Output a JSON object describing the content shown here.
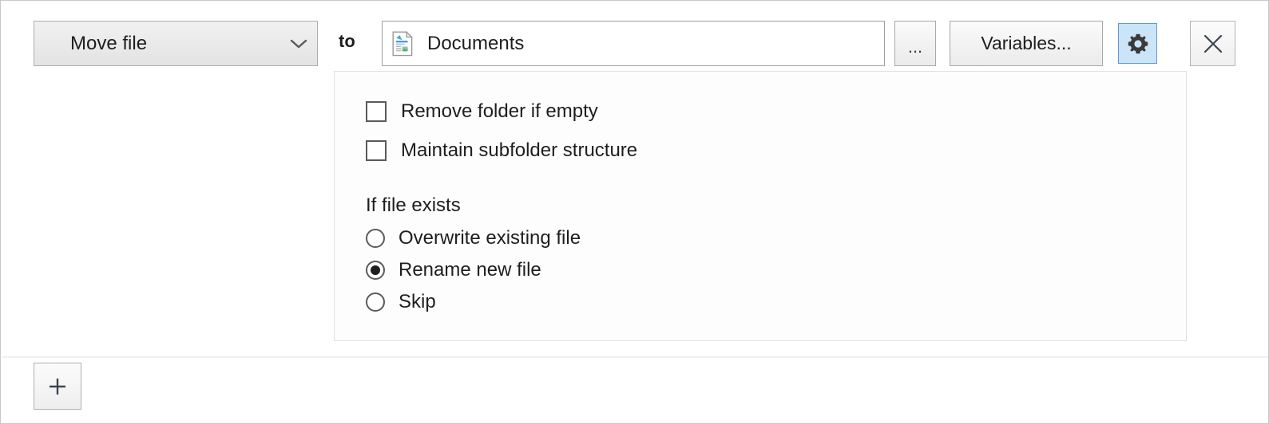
{
  "action_row": {
    "action_dropdown": {
      "selected": "Move file",
      "chevron_icon": "chevron-down-icon"
    },
    "to_label": "to",
    "path_field": {
      "value": "Documents",
      "placeholder": "Documents",
      "icon": "document-icon"
    },
    "browse_button": {
      "label": "...",
      "name": "browse-button"
    },
    "variables_button": {
      "label": "Variables...",
      "name": "variables-button"
    },
    "settings_button": {
      "icon": "gear-icon",
      "active": true,
      "accent_background": "#cce4f7",
      "accent_border": "#5b9bd5"
    },
    "close_button": {
      "icon": "close-icon"
    }
  },
  "settings_panel": {
    "checkboxes": [
      {
        "label": "Remove folder if empty",
        "checked": false,
        "name": "remove-folder-if-empty-checkbox"
      },
      {
        "label": "Maintain subfolder structure",
        "checked": false,
        "name": "maintain-subfolder-structure-checkbox"
      }
    ],
    "if_file_exists": {
      "title": "If file exists",
      "options": [
        {
          "label": "Overwrite existing file",
          "selected": false,
          "name": "radio-overwrite-existing-file"
        },
        {
          "label": "Rename new file",
          "selected": true,
          "name": "radio-rename-new-file"
        },
        {
          "label": "Skip",
          "selected": false,
          "name": "radio-skip"
        }
      ]
    }
  },
  "footer": {
    "add_button": {
      "icon": "plus-icon",
      "label": "+"
    }
  }
}
